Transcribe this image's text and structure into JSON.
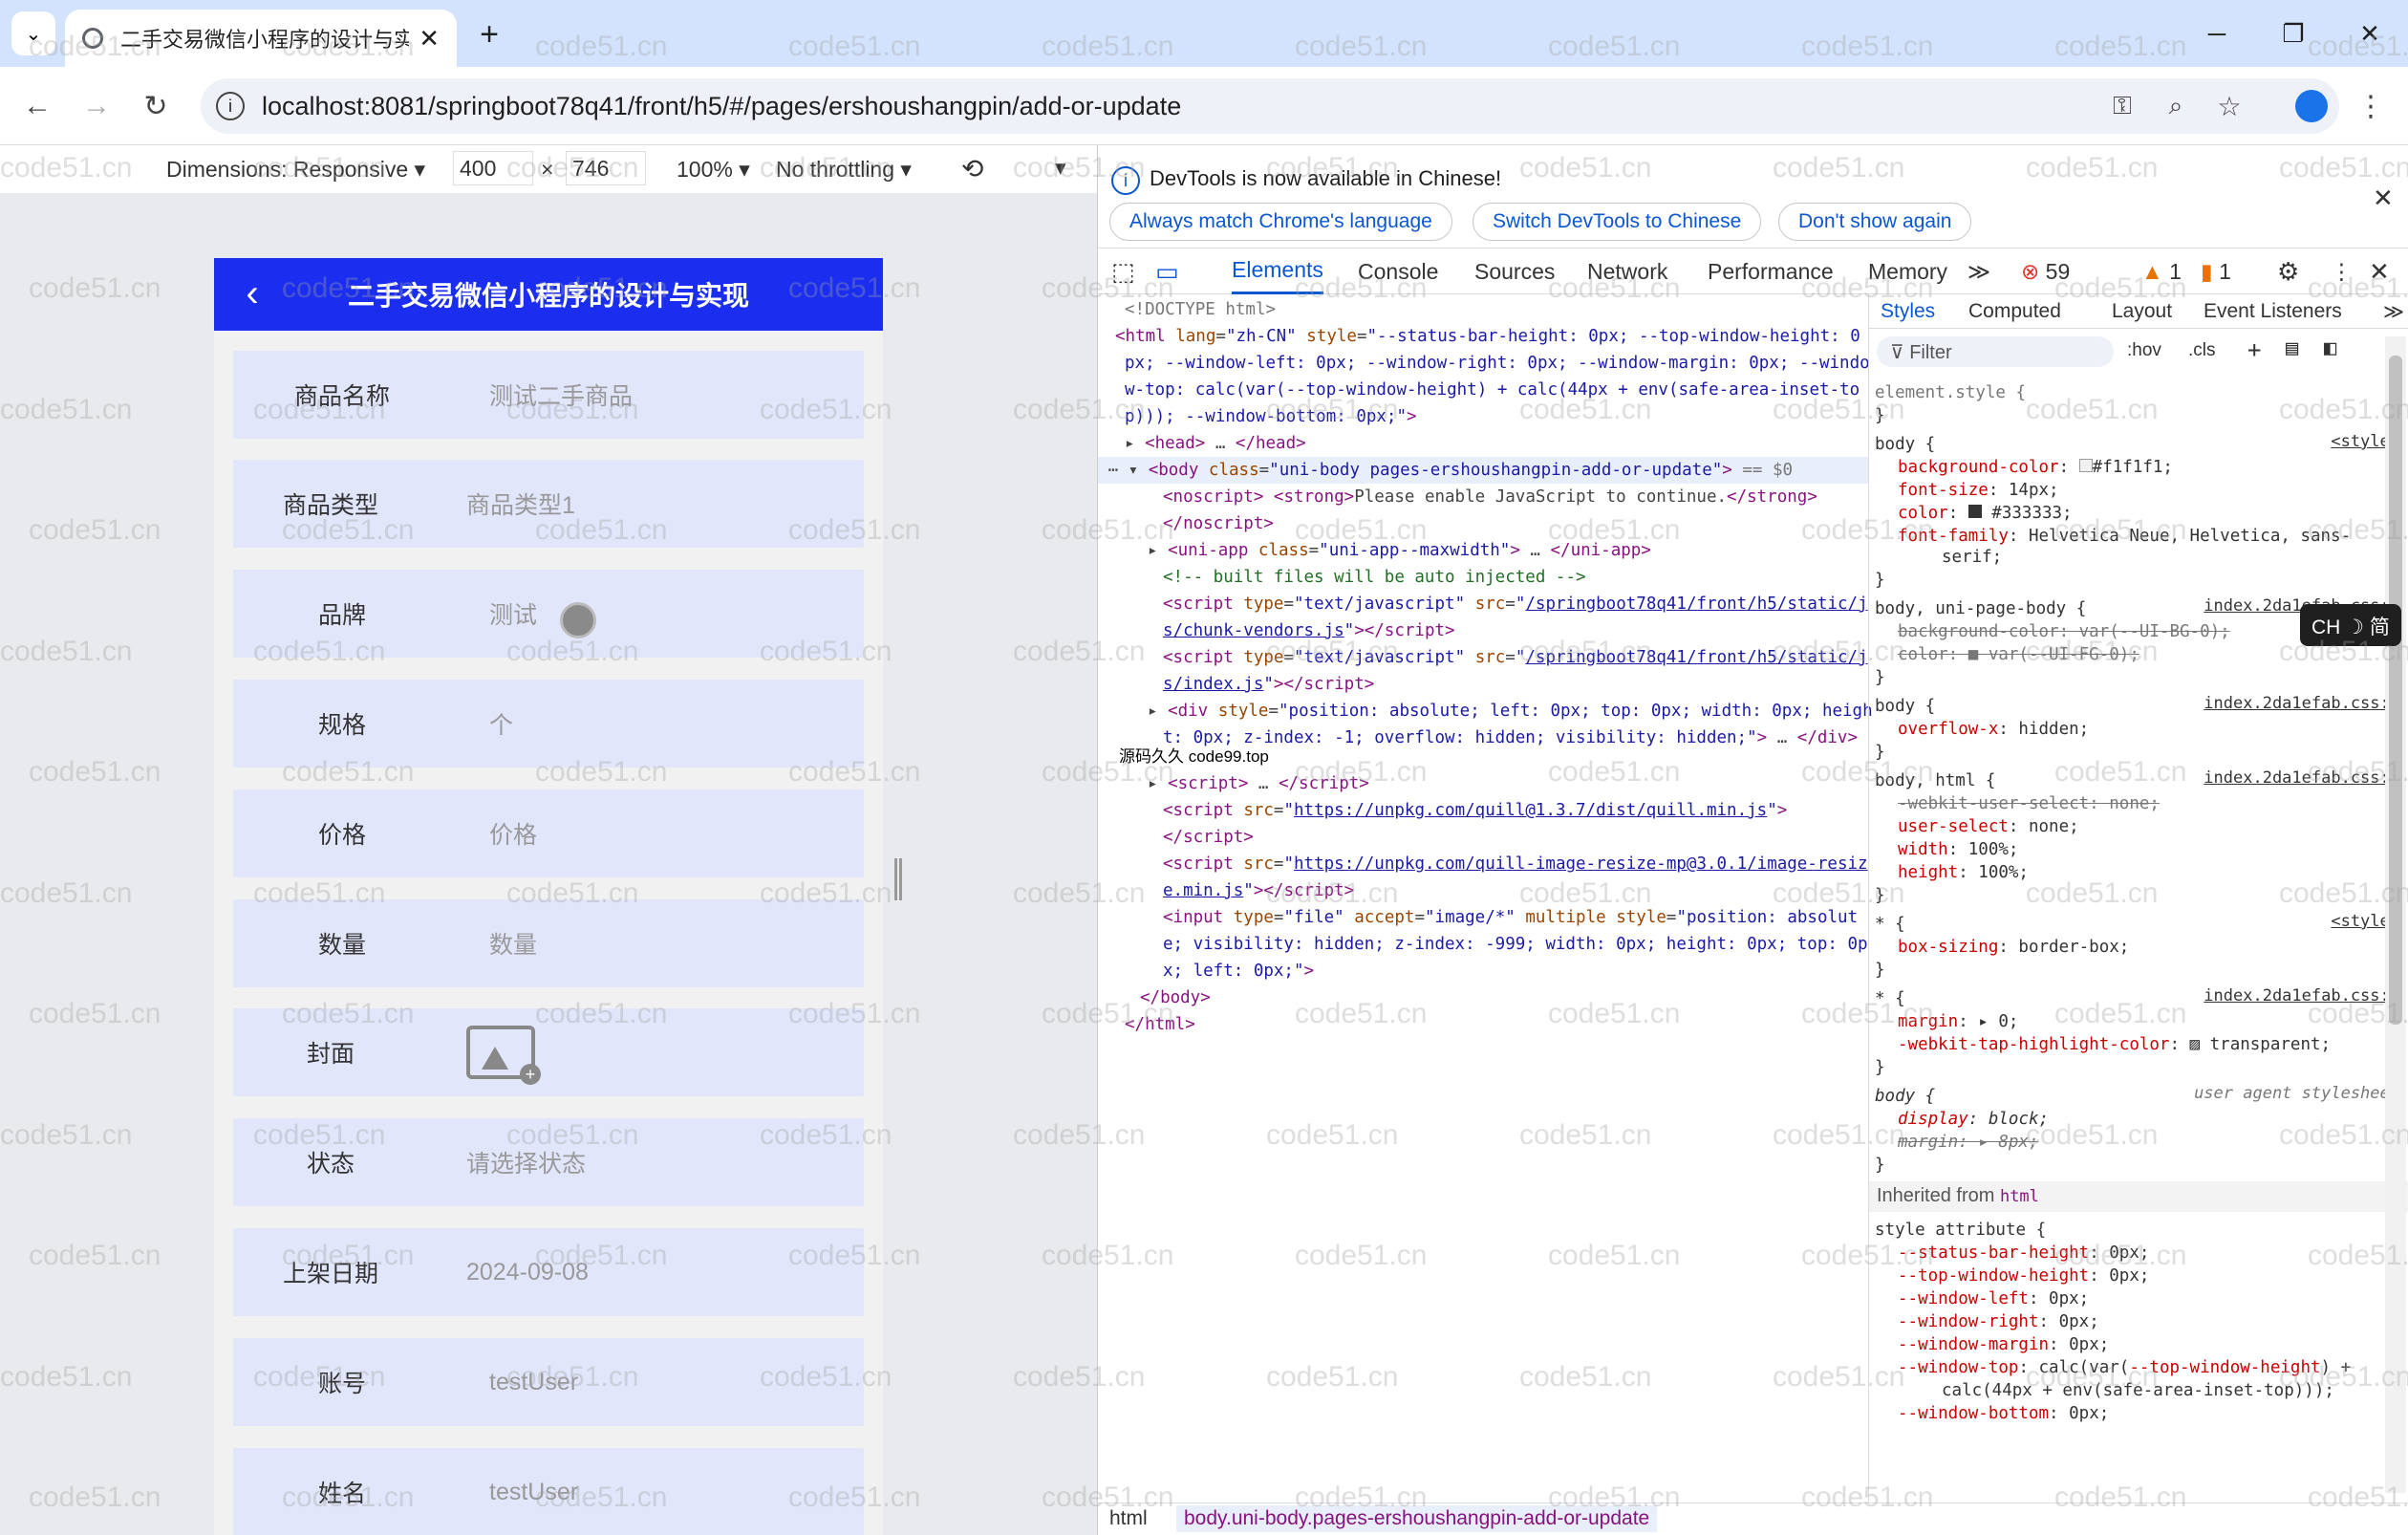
{
  "browser": {
    "tab_title": "二手交易微信小程序的设计与实",
    "url": "localhost:8081/springboot78q41/front/h5/#/pages/ershoushangpin/add-or-update",
    "new_tab": "+"
  },
  "device_toolbar": {
    "dimensions": "Dimensions: Responsive",
    "width": "400",
    "times": "×",
    "height": "746",
    "zoom": "100%",
    "throttling": "No throttling"
  },
  "app": {
    "title": "二手交易微信小程序的设计与实现",
    "back": "‹",
    "fields": [
      {
        "label": "商品名称",
        "value": "测试二手商品"
      },
      {
        "label": "商品类型",
        "value": "商品类型1"
      },
      {
        "label": "品牌",
        "value": "测试"
      },
      {
        "label": "规格",
        "value": "个"
      },
      {
        "label": "价格",
        "value": "价格"
      },
      {
        "label": "数量",
        "value": "数量"
      },
      {
        "label": "封面",
        "value": ""
      },
      {
        "label": "状态",
        "value": "请选择状态"
      },
      {
        "label": "上架日期",
        "value": "2024-09-08"
      },
      {
        "label": "账号",
        "value": "testUser"
      },
      {
        "label": "姓名",
        "value": "testUser"
      }
    ]
  },
  "devtools": {
    "info_message": "DevTools is now available in Chinese!",
    "btn_match": "Always match Chrome's language",
    "btn_switch": "Switch DevTools to Chinese",
    "btn_dont_show": "Don't show again",
    "tabs": [
      "Elements",
      "Console",
      "Sources",
      "Network",
      "Performance",
      "Memory"
    ],
    "errors": "59",
    "warnings": "1",
    "issues": "1",
    "style_tabs": [
      "Styles",
      "Computed",
      "Layout",
      "Event Listeners"
    ],
    "filter_placeholder": "Filter",
    "hov": ":hov",
    "cls": ".cls",
    "ime_badge": "CH ☽ 简",
    "overlay_text": "源码久久 code99.top",
    "breadcrumb_html": "html",
    "breadcrumb_body": "body.uni-body.pages-ershoushangpin-add-or-update",
    "inherited": "Inherited from",
    "inherited_tag": "html",
    "style_attribute": "style attribute {"
  },
  "watermark": "code51.cn",
  "colors": {
    "app_header": "#1b2ef0",
    "field_bg": "#e1e6fb",
    "chrome_tab_bar": "#d3e3fd"
  }
}
